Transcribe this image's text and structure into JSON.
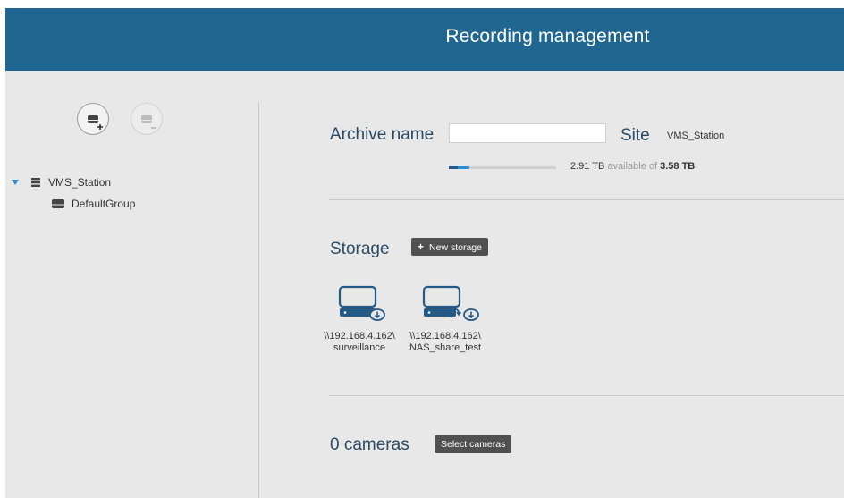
{
  "header": {
    "title": "Recording management"
  },
  "sidebar": {
    "add_button_icon": "add-storage-icon",
    "remove_button_icon": "remove-storage-icon",
    "tree": {
      "station": {
        "label": "VMS_Station",
        "expanded": true
      },
      "groups": [
        {
          "label": "DefaultGroup"
        }
      ]
    }
  },
  "archive": {
    "name_label": "Archive name",
    "name_value": "",
    "site_label": "Site",
    "site_value": "VMS_Station",
    "available": "2.91 TB",
    "available_text": "available of",
    "total": "3.58 TB",
    "usage_fraction": 0.19
  },
  "storage": {
    "title": "Storage",
    "new_button": "New storage",
    "items": [
      {
        "path_line1": "\\\\192.168.4.162\\",
        "path_line2": "surveillance",
        "icon": "nas-storage-download-icon"
      },
      {
        "path_line1": "\\\\192.168.4.162\\",
        "path_line2": "NAS_share_test",
        "icon": "nas-storage-sync-icon"
      }
    ]
  },
  "cameras": {
    "title": "0 cameras",
    "select_button": "Select cameras"
  },
  "colors": {
    "header_bg": "#1f6691",
    "panel_bg": "#e8e8e8",
    "title_text": "#2a4a62",
    "dark_button": "#505050",
    "accent": "#2e8bd0"
  }
}
